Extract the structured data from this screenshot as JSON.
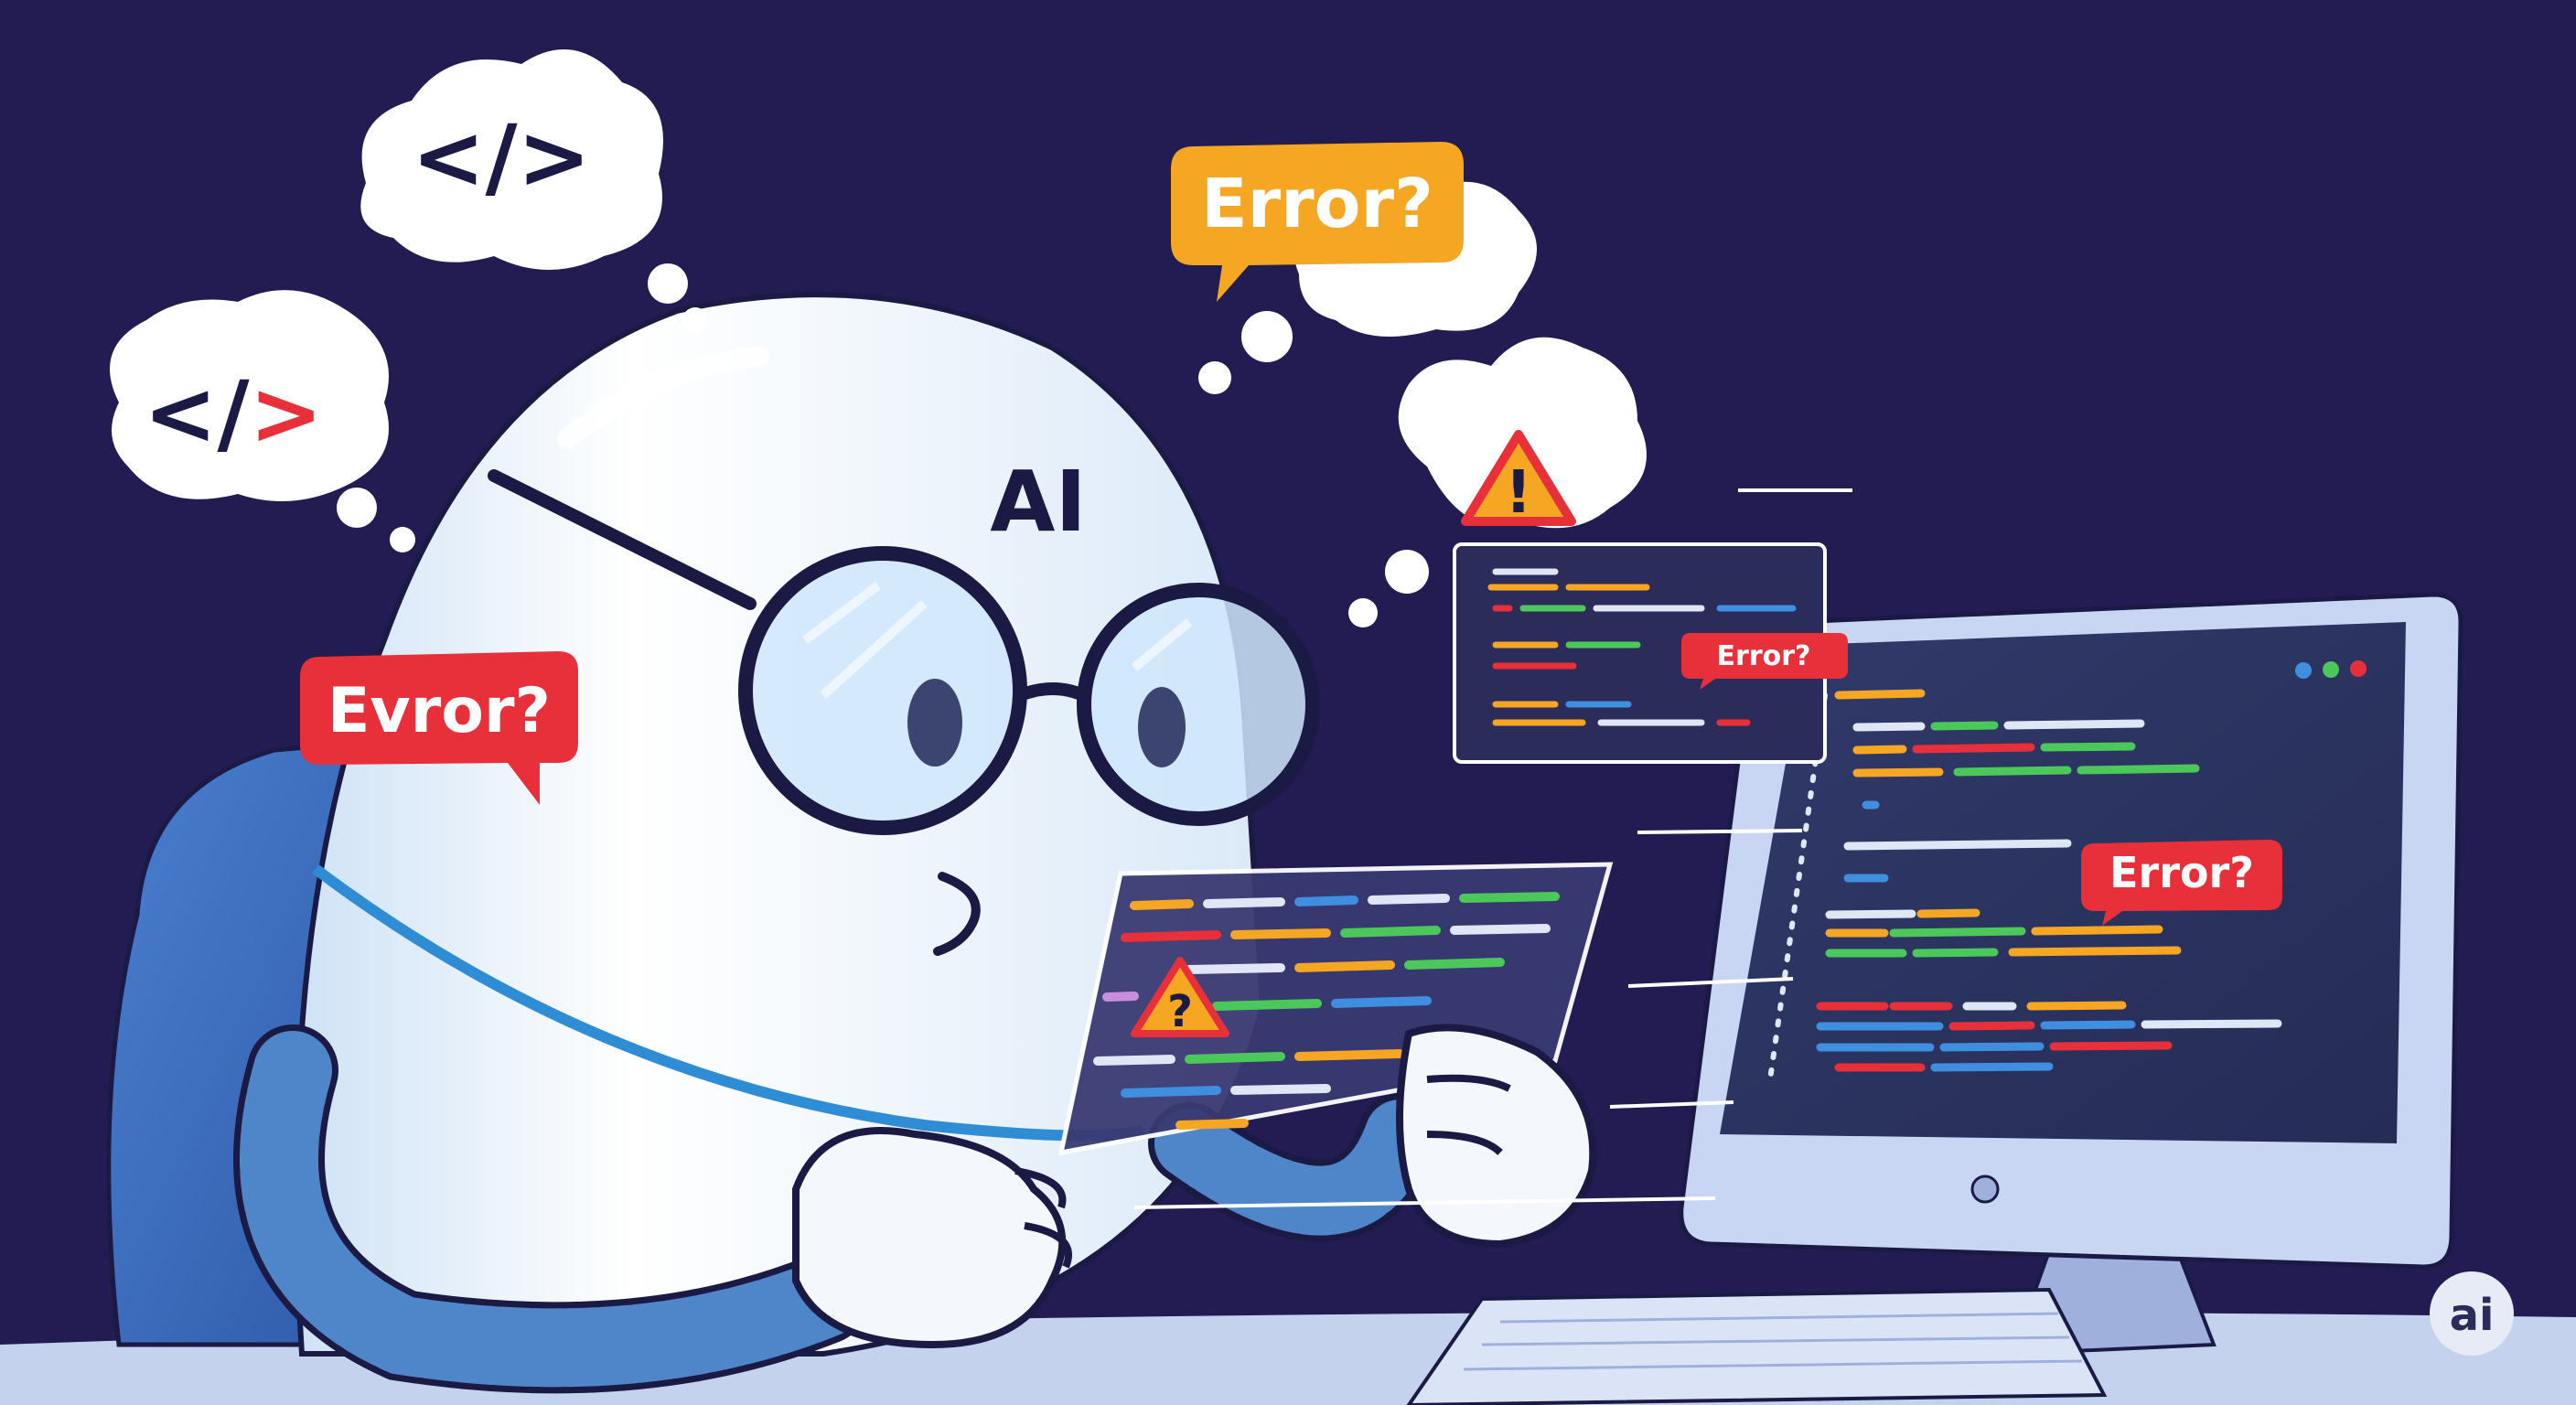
{
  "thought_bubbles": {
    "code_top": "</>",
    "code_left_open": "</",
    "code_left_close": ">",
    "warning_glyph": "!"
  },
  "speech_bubbles": {
    "top_center": "Error?",
    "left": "Evror?",
    "monitor": "Error?",
    "floating_panel": "Error?"
  },
  "robot": {
    "head_label": "AI"
  },
  "tablet": {
    "warning_glyph": "?"
  },
  "watermark": {
    "logo_text": "ai"
  },
  "colors": {
    "background": "#221c52",
    "robot_body": "#f4f8fd",
    "robot_shade": "#c9def5",
    "outline": "#1b1a45",
    "error_red": "#e8303b",
    "error_orange": "#f5a623",
    "code_green": "#4cc85a",
    "code_blue": "#3f8ee0",
    "screen_bg": "#2d3560"
  }
}
